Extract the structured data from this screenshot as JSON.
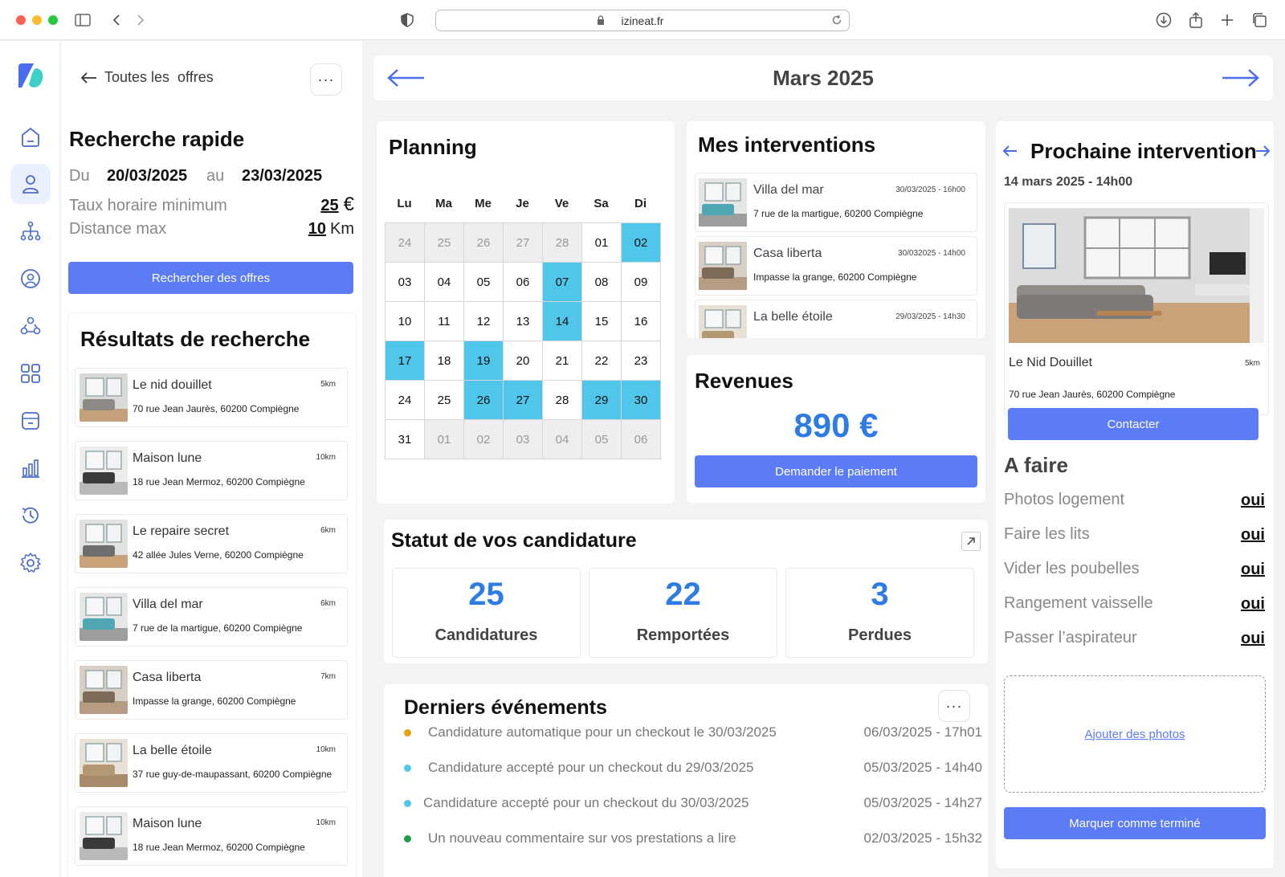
{
  "browser": {
    "url": "izineat.fr"
  },
  "panel": {
    "back_label": "Toutes les  offres",
    "more": "···",
    "quick_search_title": "Recherche rapide",
    "from_label": "Du",
    "from_value": "20/03/2025",
    "to_label": "au",
    "to_value": "23/03/2025",
    "rate_label": "Taux horaire minimum",
    "rate_value": "25",
    "rate_unit": "€",
    "distance_label": "Distance max",
    "distance_value": "10",
    "distance_unit": "Km",
    "search_button": "Rechercher des offres",
    "results_title": "Résultats de recherche",
    "results": [
      {
        "name": "Le nid douillet",
        "address": "70 rue Jean Jaurès, 60200 Compiègne",
        "distance": "5km"
      },
      {
        "name": "Maison lune",
        "address": "18 rue Jean Mermoz, 60200 Compiègne",
        "distance": "10km"
      },
      {
        "name": "Le repaire secret",
        "address": "42 allée Jules Verne, 60200 Compiègne",
        "distance": "6km"
      },
      {
        "name": "Villa del mar",
        "address": "7 rue de la martigue, 60200 Compiègne",
        "distance": "6km"
      },
      {
        "name": "Casa liberta",
        "address": "Impasse la grange, 60200 Compiègne",
        "distance": "7km"
      },
      {
        "name": "La belle étoile",
        "address": "37 rue guy-de-maupassant, 60200 Compiègne",
        "distance": "10km"
      },
      {
        "name": "Maison lune",
        "address": "18 rue Jean Mermoz, 60200 Compiègne",
        "distance": "10km"
      }
    ]
  },
  "month": {
    "title": "Mars 2025"
  },
  "planning": {
    "title": "Planning",
    "weekdays": [
      "Lu",
      "Ma",
      "Me",
      "Je",
      "Ve",
      "Sa",
      "Di"
    ],
    "days": [
      {
        "d": "24",
        "s": "out"
      },
      {
        "d": "25",
        "s": "out"
      },
      {
        "d": "26",
        "s": "out"
      },
      {
        "d": "27",
        "s": "out"
      },
      {
        "d": "28",
        "s": "out"
      },
      {
        "d": "01",
        "s": ""
      },
      {
        "d": "02",
        "s": "hl"
      },
      {
        "d": "03",
        "s": ""
      },
      {
        "d": "04",
        "s": ""
      },
      {
        "d": "05",
        "s": ""
      },
      {
        "d": "06",
        "s": ""
      },
      {
        "d": "07",
        "s": "hl"
      },
      {
        "d": "08",
        "s": ""
      },
      {
        "d": "09",
        "s": ""
      },
      {
        "d": "10",
        "s": ""
      },
      {
        "d": "11",
        "s": ""
      },
      {
        "d": "12",
        "s": ""
      },
      {
        "d": "13",
        "s": ""
      },
      {
        "d": "14",
        "s": "hl"
      },
      {
        "d": "15",
        "s": ""
      },
      {
        "d": "16",
        "s": ""
      },
      {
        "d": "17",
        "s": "hl"
      },
      {
        "d": "18",
        "s": ""
      },
      {
        "d": "19",
        "s": "hl"
      },
      {
        "d": "20",
        "s": ""
      },
      {
        "d": "21",
        "s": ""
      },
      {
        "d": "22",
        "s": ""
      },
      {
        "d": "23",
        "s": ""
      },
      {
        "d": "24",
        "s": ""
      },
      {
        "d": "25",
        "s": ""
      },
      {
        "d": "26",
        "s": "hl"
      },
      {
        "d": "27",
        "s": "hl"
      },
      {
        "d": "28",
        "s": ""
      },
      {
        "d": "29",
        "s": "hl"
      },
      {
        "d": "30",
        "s": "hl"
      },
      {
        "d": "31",
        "s": ""
      },
      {
        "d": "01",
        "s": "out"
      },
      {
        "d": "02",
        "s": "out"
      },
      {
        "d": "03",
        "s": "out"
      },
      {
        "d": "04",
        "s": "out"
      },
      {
        "d": "05",
        "s": "out"
      },
      {
        "d": "06",
        "s": "out"
      }
    ]
  },
  "interventions": {
    "title": "Mes interventions",
    "items": [
      {
        "name": "Villa del mar",
        "address": "7 rue de la martigue, 60200 Compiègne",
        "date": "30/03/2025 - 16h00"
      },
      {
        "name": "Casa liberta",
        "address": "Impasse la grange, 60200 Compiègne",
        "date": "30/032025 - 14h00"
      },
      {
        "name": "La belle étoile",
        "address": "",
        "date": "29/03/2025 - 14h30"
      }
    ]
  },
  "revenues": {
    "title": "Revenues",
    "amount": "890 €",
    "button": "Demander le paiement"
  },
  "applications": {
    "title": "Statut de vos candidature",
    "stats": [
      {
        "value": "25",
        "label": "Candidatures"
      },
      {
        "value": "22",
        "label": "Remportées"
      },
      {
        "value": "3",
        "label": "Perdues"
      }
    ]
  },
  "events": {
    "title": "Derniers événements",
    "more": "···",
    "items": [
      {
        "text": "Candidature automatique  pour un checkout le 30/03/2025",
        "date": "06/03/2025 - 17h01",
        "color": "#e5a30f"
      },
      {
        "text": "Candidature accepté pour un checkout du 29/03/2025",
        "date": "05/03/2025 - 14h40",
        "color": "#4fc6ea"
      },
      {
        "text": "Candidature accepté pour un checkout du 30/03/2025",
        "date": "05/03/2025 - 14h27",
        "color": "#4fc6ea"
      },
      {
        "text": "Un nouveau commentaire sur vos prestations a lire",
        "date": "02/03/2025 - 15h32",
        "color": "#1f9e4a"
      }
    ]
  },
  "next": {
    "title": "Prochaine intervention",
    "datetime": "14 mars 2025 - 14h00",
    "name": "Le Nid Douillet",
    "distance": "5km",
    "address": "70 rue Jean Jaurès, 60200 Compiègne",
    "contact_button": "Contacter",
    "todo_title": "A faire",
    "todo": [
      {
        "label": "Photos logement",
        "value": "oui"
      },
      {
        "label": "Faire les lits",
        "value": "oui"
      },
      {
        "label": "Vider les poubelles",
        "value": "oui"
      },
      {
        "label": "Rangement vaisselle",
        "value": "oui"
      },
      {
        "label": "Passer l’aspirateur",
        "value": "oui"
      }
    ],
    "add_photos": "Ajouter des photos",
    "done_button": "Marquer comme terminé"
  },
  "colors": {
    "accent": "#5b7cf5",
    "highlight": "#4fc6ea",
    "stat": "#2d7be5"
  }
}
